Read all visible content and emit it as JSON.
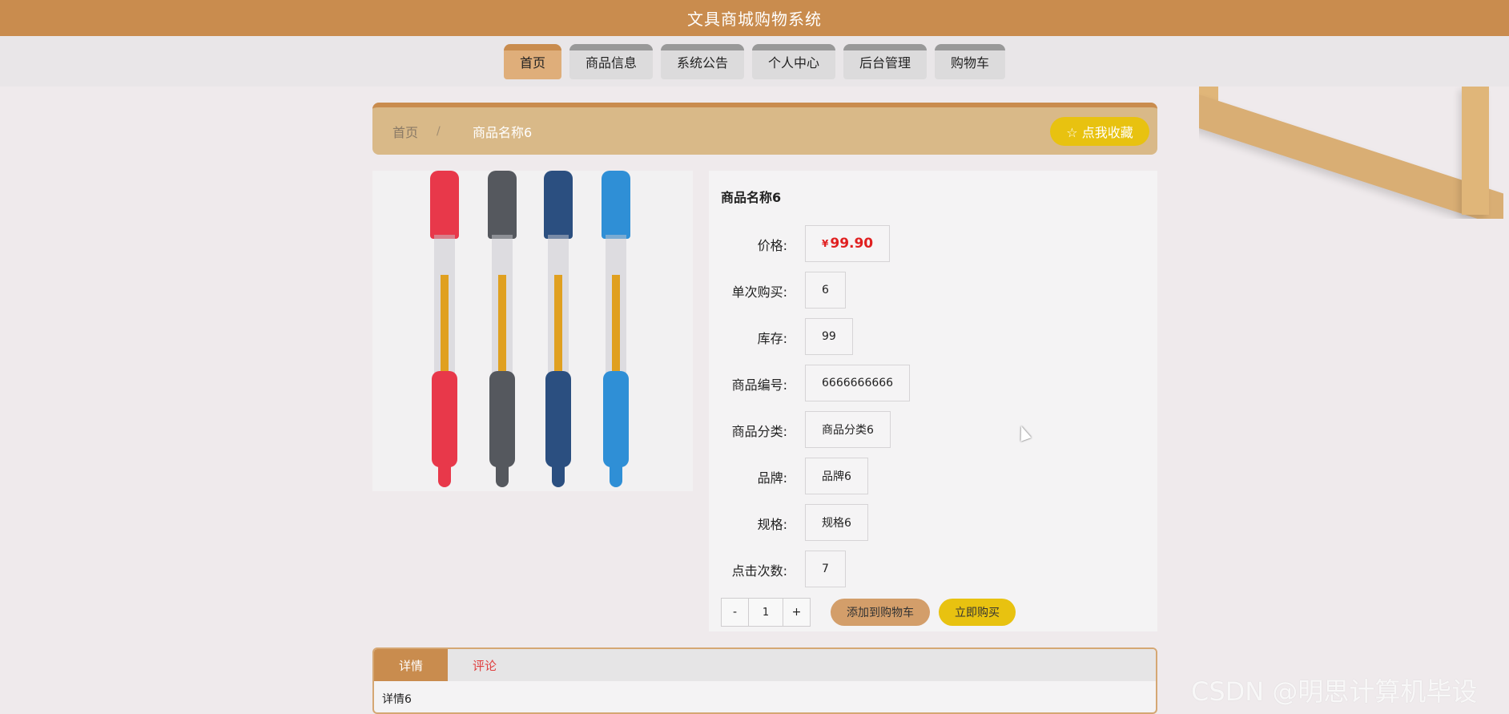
{
  "header": {
    "title": "文具商城购物系统"
  },
  "nav": {
    "items": [
      "首页",
      "商品信息",
      "系统公告",
      "个人中心",
      "后台管理",
      "购物车"
    ],
    "active_index": 0
  },
  "breadcrumb": {
    "home": "首页",
    "separator": "/",
    "current": "商品名称6"
  },
  "favorite_button": "☆ 点我收藏",
  "product": {
    "name": "商品名称6",
    "price_label": "价格:",
    "currency": "¥",
    "price": "99.90",
    "fields": [
      {
        "label": "单次购买:",
        "value": "6"
      },
      {
        "label": "库存:",
        "value": "99"
      },
      {
        "label": "商品编号:",
        "value": "6666666666"
      },
      {
        "label": "商品分类:",
        "value": "商品分类6"
      },
      {
        "label": "品牌:",
        "value": "品牌6"
      },
      {
        "label": "规格:",
        "value": "规格6"
      },
      {
        "label": "点击次数:",
        "value": "7"
      }
    ],
    "pen_colors": [
      "#e8384a",
      "#55585e",
      "#2b4f80",
      "#2f8fd6"
    ]
  },
  "quantity": {
    "minus": "-",
    "value": "1",
    "plus": "+"
  },
  "actions": {
    "add_to_cart": "添加到购物车",
    "buy_now": "立即购买"
  },
  "tabs": {
    "items": [
      "详情",
      "评论"
    ],
    "content": "详情6"
  },
  "watermark": "CSDN @明思计算机毕设"
}
